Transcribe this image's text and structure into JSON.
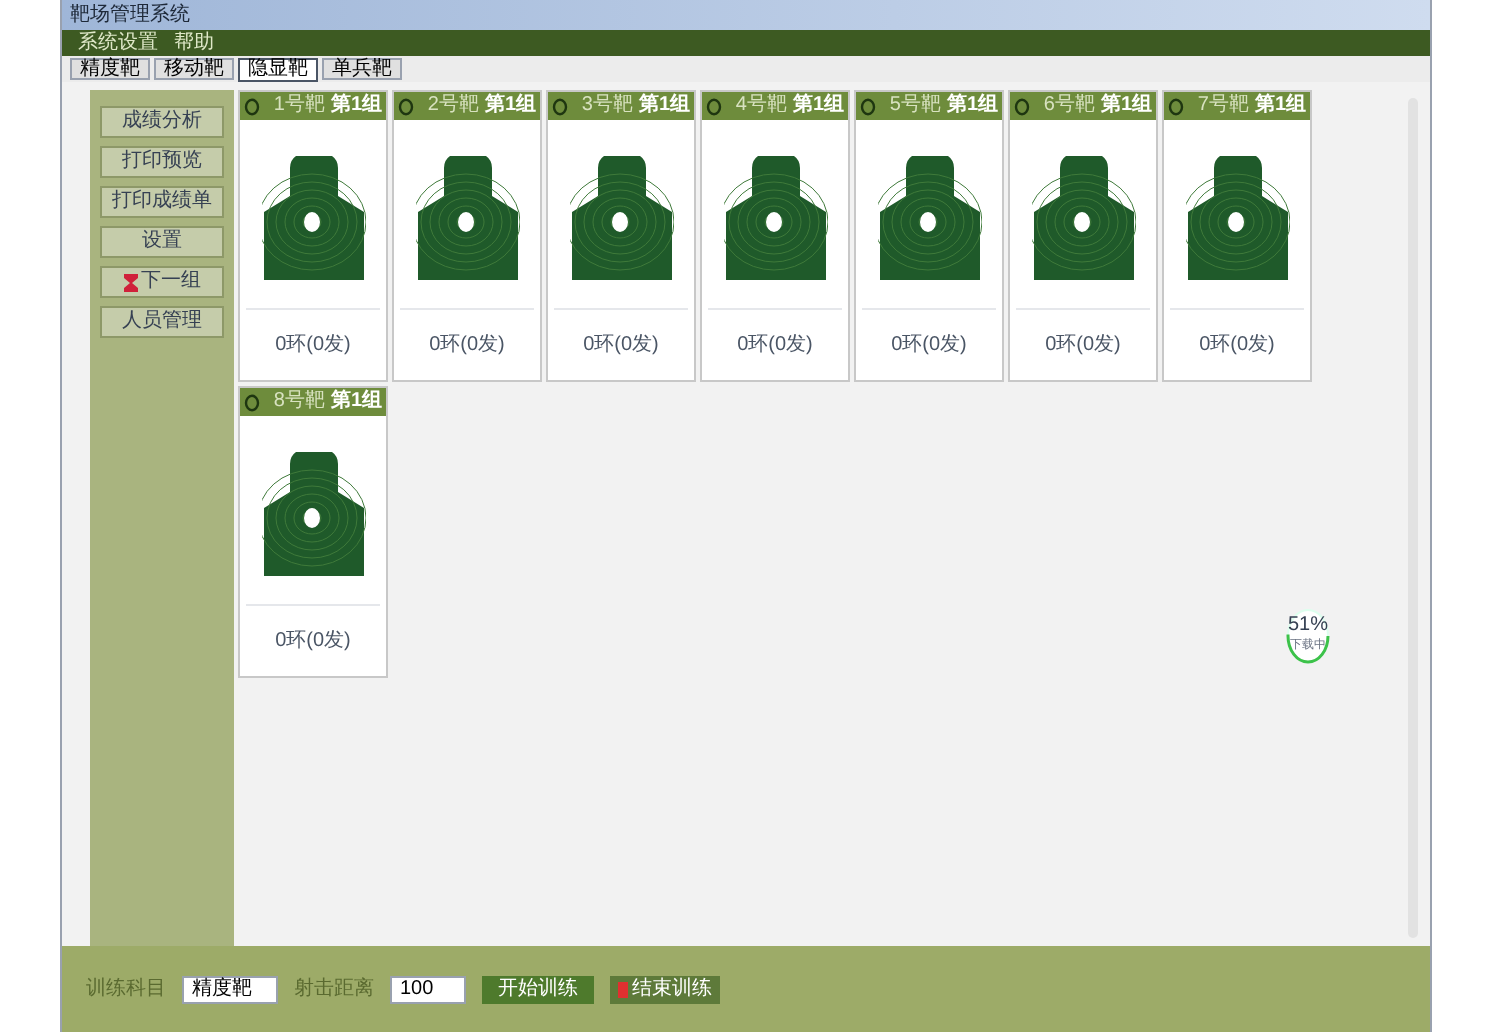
{
  "window": {
    "title": "靶场管理系统"
  },
  "menu": [
    "系统设置",
    "帮助"
  ],
  "tabs": [
    {
      "label": "精度靶",
      "selected": false
    },
    {
      "label": "移动靶",
      "selected": false
    },
    {
      "label": "隐显靶",
      "selected": true
    },
    {
      "label": "单兵靶",
      "selected": false
    }
  ],
  "sidebar": {
    "items": [
      {
        "label": "成绩分析",
        "kind": "button"
      },
      {
        "label": "打印预览",
        "kind": "button"
      },
      {
        "label": "打印成绩单",
        "kind": "button"
      },
      {
        "label": "设置",
        "kind": "button"
      },
      {
        "label": "下一组",
        "kind": "icon-button"
      },
      {
        "label": "人员管理",
        "kind": "button"
      }
    ]
  },
  "targets": [
    {
      "name": "1号靶",
      "group": "第1组",
      "result": "0环(0发)"
    },
    {
      "name": "2号靶",
      "group": "第1组",
      "result": "0环(0发)"
    },
    {
      "name": "3号靶",
      "group": "第1组",
      "result": "0环(0发)"
    },
    {
      "name": "4号靶",
      "group": "第1组",
      "result": "0环(0发)"
    },
    {
      "name": "5号靶",
      "group": "第1组",
      "result": "0环(0发)"
    },
    {
      "name": "6号靶",
      "group": "第1组",
      "result": "0环(0发)"
    },
    {
      "name": "7号靶",
      "group": "第1组",
      "result": "0环(0发)"
    },
    {
      "name": "8号靶",
      "group": "第1组",
      "result": "0环(0发)"
    }
  ],
  "progress": {
    "reading": "51%",
    "caption": "下载中",
    "level": 0.51
  },
  "bottom_bar": {
    "subject_label": "训练科目",
    "subject_value": "精度靶",
    "distance_label": "射击距离",
    "distance_value": "100",
    "start_button": "开始训练",
    "stop_button": "结束训练"
  }
}
